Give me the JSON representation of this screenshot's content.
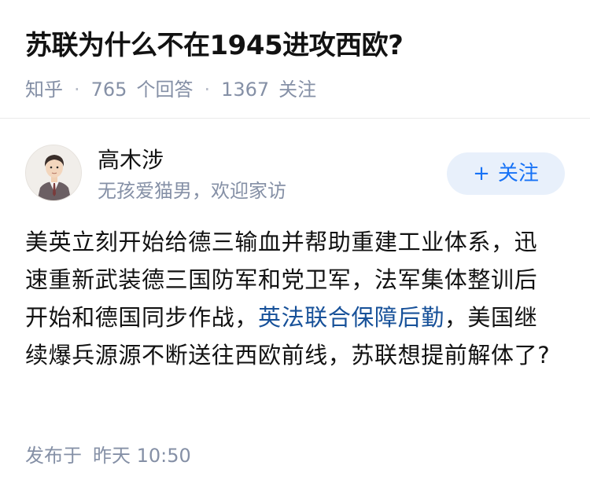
{
  "question": {
    "title": "苏联为什么不在1945进攻西欧?",
    "source": "知乎",
    "answer_count": "765",
    "answer_label": "个回答",
    "follower_count": "1367",
    "follower_label": "关注",
    "separator": "·"
  },
  "author": {
    "name": "高木涉",
    "bio": "无孩爱猫男，欢迎家访",
    "follow_plus": "+",
    "follow_label": "关注",
    "avatar_icon": "person-avatar-icon"
  },
  "answer": {
    "text_before_link": "美英立刻开始给德三输血并帮助重建工业体系，迅速重新武装德三国防军和党卫军，法军集体整训后开始和德国同步作战，",
    "link_text": "英法联合保障后勤",
    "text_after_link": "，美国继续爆兵源源不断送往西欧前线，苏联想提前解体了?"
  },
  "footer": {
    "publish_label": "发布于",
    "publish_time": "昨天 10:50"
  },
  "colors": {
    "link": "#175199",
    "meta": "#8590a6",
    "follow_bg": "#e8f0fb",
    "follow_text": "#1772f6"
  }
}
